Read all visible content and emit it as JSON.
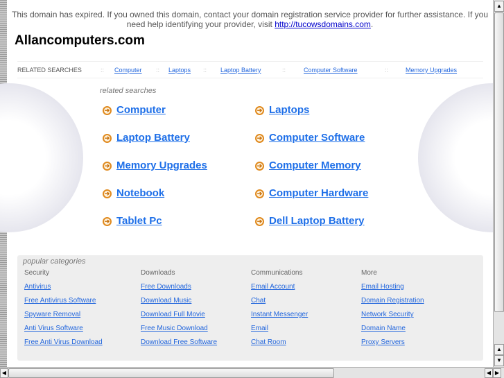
{
  "notice": {
    "text": "This domain has expired. If you owned this domain, contact your domain registration service provider for further assistance. If you need help identifying your provider, visit ",
    "link": "http://tucowsdomains.com",
    "end": "."
  },
  "site_title": "Allancomputers.com",
  "related_bar": {
    "label": "RELATED SEARCHES",
    "sep": "::",
    "links": [
      "Computer",
      "Laptops",
      "Laptop Battery",
      "Computer Software",
      "Memory Upgrades"
    ]
  },
  "related": {
    "label": "related searches",
    "items": [
      "Computer",
      "Laptops",
      "Laptop Battery",
      "Computer Software",
      "Memory Upgrades",
      "Computer Memory",
      "Notebook",
      "Computer Hardware",
      "Tablet Pc",
      "Dell Laptop Battery"
    ]
  },
  "popular": {
    "label": "popular categories",
    "columns": [
      {
        "title": "Security",
        "links": [
          "Antivirus",
          "Free Antivirus Software",
          "Spyware Removal",
          "Anti Virus Software",
          "Free Anti Virus Download"
        ]
      },
      {
        "title": "Downloads",
        "links": [
          "Free Downloads",
          "Download Music",
          "Download Full Movie",
          "Free Music Download",
          "Download Free Software"
        ]
      },
      {
        "title": "Communications",
        "links": [
          "Email Account",
          "Chat",
          "Instant Messenger",
          "Email",
          "Chat Room"
        ]
      },
      {
        "title": "More",
        "links": [
          "Email Hosting",
          "Domain Registration",
          "Network Security",
          "Domain Name",
          "Proxy Servers"
        ]
      }
    ]
  }
}
